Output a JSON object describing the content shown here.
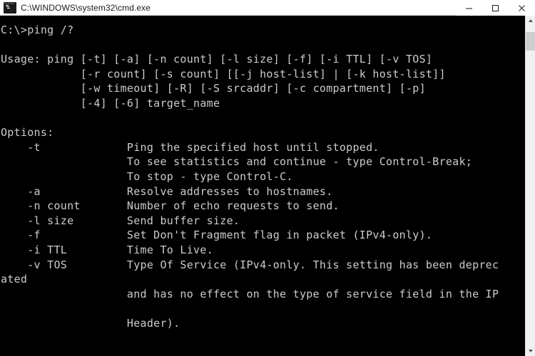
{
  "window": {
    "title": "C:\\WINDOWS\\system32\\cmd.exe",
    "icon": "cmd-icon",
    "controls": {
      "minimize_label": "Minimize",
      "maximize_label": "Maximize",
      "close_label": "Close"
    }
  },
  "console": {
    "background_color": "#000000",
    "text_color": "#cccccc",
    "lines": [
      "C:\\>ping /?",
      "",
      "Usage: ping [-t] [-a] [-n count] [-l size] [-f] [-i TTL] [-v TOS]",
      "            [-r count] [-s count] [[-j host-list] | [-k host-list]]",
      "            [-w timeout] [-R] [-S srcaddr] [-c compartment] [-p]",
      "            [-4] [-6] target_name",
      "",
      "Options:",
      "    -t             Ping the specified host until stopped.",
      "                   To see statistics and continue - type Control-Break;",
      "                   To stop - type Control-C.",
      "    -a             Resolve addresses to hostnames.",
      "    -n count       Number of echo requests to send.",
      "    -l size        Send buffer size.",
      "    -f             Set Don't Fragment flag in packet (IPv4-only).",
      "    -i TTL         Time To Live.",
      "    -v TOS         Type Of Service (IPv4-only. This setting has been deprec",
      "ated",
      "                   and has no effect on the type of service field in the IP",
      "",
      "                   Header)."
    ]
  },
  "scrollbar": {
    "up_arrow": "chevron-up-icon",
    "down_arrow": "chevron-down-icon",
    "thumb_position_percent": 2
  }
}
